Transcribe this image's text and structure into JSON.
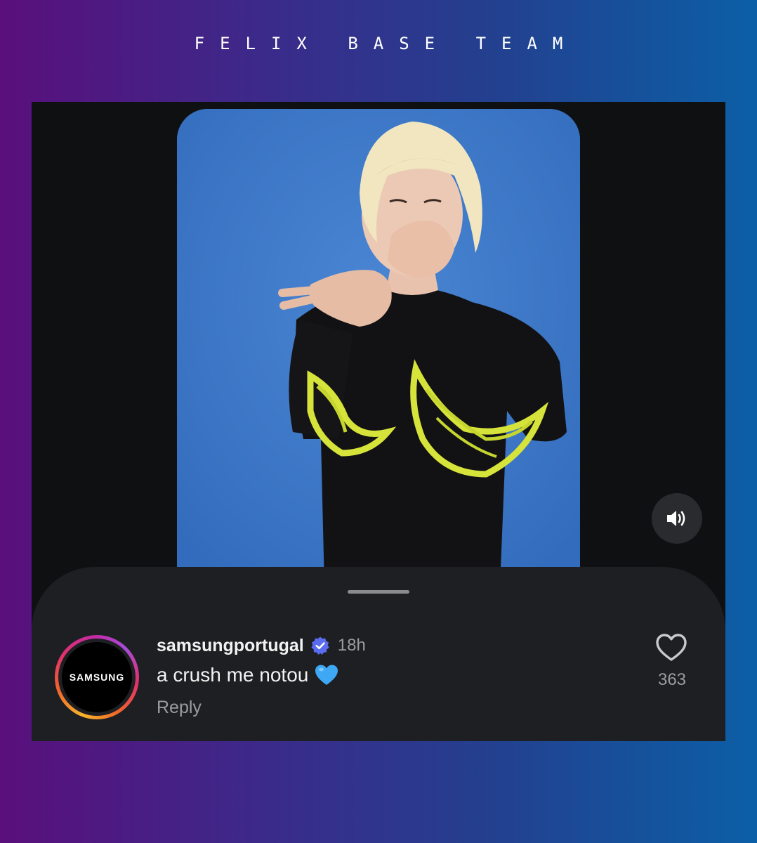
{
  "page": {
    "title": "FELIX BASE TEAM"
  },
  "post": {
    "media_type": "video",
    "sound_icon": "speaker-volume-icon"
  },
  "comment": {
    "username": "samsungportugal",
    "verified": true,
    "timestamp": "18h",
    "text": "a crush me notou",
    "emoji": "blue-heart",
    "reply_label": "Reply",
    "like_count": "363",
    "avatar_logo_text": "SAMSUNG"
  },
  "colors": {
    "background_gradient_start": "#5a0f7c",
    "background_gradient_end": "#0b5fa6",
    "video_background": "#3c78c8",
    "sheet_background": "#1e1f22",
    "verified_badge": "#5a6cf0",
    "heart_emoji": "#3fa8f5",
    "secondary_text": "#9a9ca1"
  }
}
